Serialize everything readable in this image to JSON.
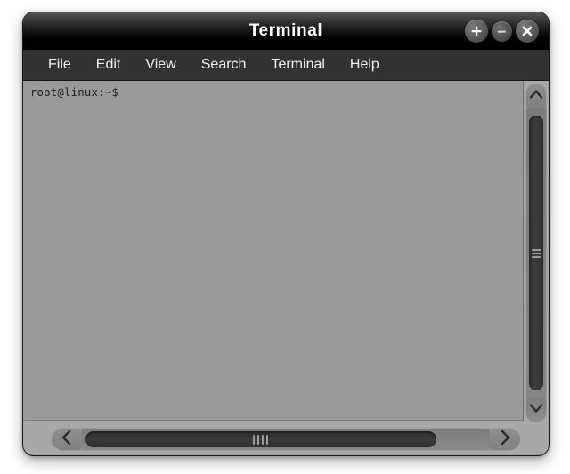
{
  "window": {
    "title": "Terminal",
    "controls": [
      {
        "name": "maximize",
        "glyph": "plus"
      },
      {
        "name": "minimize",
        "glyph": "minus"
      },
      {
        "name": "close",
        "glyph": "x"
      }
    ],
    "colors": {
      "titlebar_top": "#555555",
      "titlebar_bottom": "#000000",
      "menubar_bg": "#323232",
      "menu_text": "#f2f2f2",
      "terminal_bg": "#9a9a9a",
      "terminal_text": "#1c1c1c",
      "frame_bg": "#a8a8a8",
      "scrollbar_track": "#7d7d7d",
      "scrollbar_thumb": "#303030",
      "page_bg": "#ffffff"
    }
  },
  "menubar": {
    "items": [
      {
        "label": "File"
      },
      {
        "label": "Edit"
      },
      {
        "label": "View"
      },
      {
        "label": "Search"
      },
      {
        "label": "Terminal"
      },
      {
        "label": "Help"
      }
    ]
  },
  "terminal": {
    "lines": [
      "root@linux:~$"
    ],
    "prompt": "root@linux:~$",
    "user": "root",
    "host": "linux",
    "cwd": "~"
  },
  "scrollbars": {
    "vertical": {
      "up_icon": "chevron-up-icon",
      "down_icon": "chevron-down-icon",
      "grip_count": 3,
      "thumb_position": "full"
    },
    "horizontal": {
      "left_icon": "chevron-left-icon",
      "right_icon": "chevron-right-icon",
      "grip_count": 4,
      "thumb_position": "full"
    }
  }
}
